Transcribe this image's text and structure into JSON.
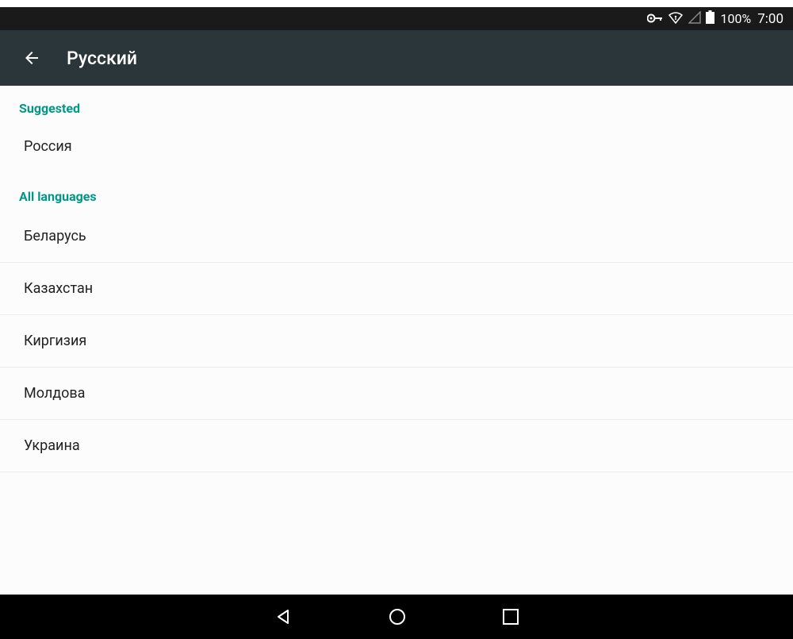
{
  "statusBar": {
    "batteryPercent": "100%",
    "time": "7:00"
  },
  "appBar": {
    "title": "Русский"
  },
  "sections": {
    "suggested": {
      "header": "Suggested",
      "items": [
        "Россия"
      ]
    },
    "allLanguages": {
      "header": "All languages",
      "items": [
        "Беларусь",
        "Казахстан",
        "Киргизия",
        "Молдова",
        "Украина"
      ]
    }
  }
}
